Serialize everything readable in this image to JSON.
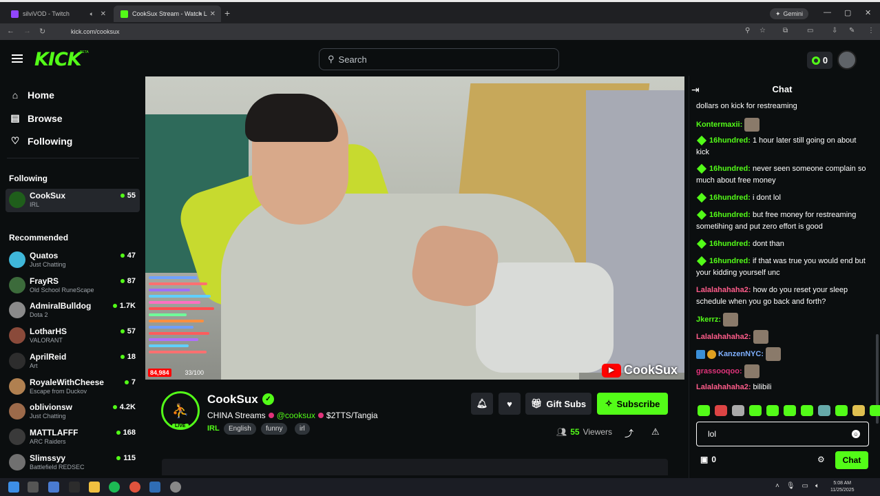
{
  "browser": {
    "tabs": [
      {
        "title": "silviVOD - Twitch",
        "favicon_color": "#9146ff"
      },
      {
        "title": "CookSux Stream - Watch L",
        "favicon_color": "#53fc18"
      }
    ],
    "new_tab": "+",
    "gemini_label": "Gemini",
    "url": "kick.com/cooksux"
  },
  "header": {
    "logo": "KICK",
    "logo_sup": "BETA",
    "search_placeholder": "Search",
    "coins": "0"
  },
  "sidebar": {
    "nav": [
      {
        "label": "Home",
        "icon": "home-icon"
      },
      {
        "label": "Browse",
        "icon": "browse-icon"
      },
      {
        "label": "Following",
        "icon": "heart-icon"
      }
    ],
    "following_heading": "Following",
    "following": [
      {
        "name": "CookSux",
        "category": "IRL",
        "viewers": "55",
        "avatar_color": "#1f5e1b"
      }
    ],
    "recommended_heading": "Recommended",
    "recommended": [
      {
        "name": "Quatos",
        "category": "Just Chatting",
        "viewers": "47",
        "avatar_color": "#3fb7d9"
      },
      {
        "name": "FrayRS",
        "category": "Old School RuneScape",
        "viewers": "87",
        "avatar_color": "#3c6b3b"
      },
      {
        "name": "AdmiralBulldog",
        "category": "Dota 2",
        "viewers": "1.7K",
        "avatar_color": "#8a8a8a"
      },
      {
        "name": "LotharHS",
        "category": "VALORANT",
        "viewers": "57",
        "avatar_color": "#8a4a3a"
      },
      {
        "name": "AprilReid",
        "category": "Art",
        "viewers": "18",
        "avatar_color": "#2d2d2d"
      },
      {
        "name": "RoyaleWithCheese",
        "category": "Escape from Duckov",
        "viewers": "7",
        "avatar_color": "#b08050"
      },
      {
        "name": "oblivionsw",
        "category": "Just Chatting",
        "viewers": "4.2K",
        "avatar_color": "#9c6a4a"
      },
      {
        "name": "MATTLAFFF",
        "category": "ARC Raiders",
        "viewers": "168",
        "avatar_color": "#3a3a3a"
      },
      {
        "name": "Slimssyy",
        "category": "Battlefield REDSEC",
        "viewers": "115",
        "avatar_color": "#707070"
      }
    ]
  },
  "video": {
    "viewer_count_overlay": "84,984",
    "overlay_counter": "33/100",
    "watermark": "CookSux"
  },
  "channel": {
    "name": "CookSux",
    "live_badge": "LIVE",
    "title_prefix": "CHINA Streams",
    "title_handle": "@cooksux",
    "title_suffix": "$2TTS/Tangia",
    "category": "IRL",
    "tags": [
      "English",
      "funny",
      "irl"
    ],
    "viewers": "55",
    "viewers_label": "Viewers",
    "gift_label": "Gift Subs",
    "subscribe_label": "Subscribe"
  },
  "chat": {
    "title": "Chat",
    "messages": [
      {
        "user": "",
        "text": "dollars on kick for restreaming",
        "color": "#ffffff"
      },
      {
        "user": "Kontermaxii:",
        "text": "",
        "color": "#53fc18"
      },
      {
        "user": "16hundred:",
        "text": "1 hour later still going on about kick",
        "color": "#53fc18"
      },
      {
        "user": "16hundred:",
        "text": "never seen someone complain so much about free money",
        "color": "#53fc18"
      },
      {
        "user": "16hundred:",
        "text": "i dont lol",
        "color": "#53fc18"
      },
      {
        "user": "16hundred:",
        "text": "but free money for restreaming sometihing and put zero effort is good",
        "color": "#53fc18"
      },
      {
        "user": "16hundred:",
        "text": "dont than",
        "color": "#53fc18"
      },
      {
        "user": "16hundred:",
        "text": "if that was true you would end but your kidding yourself unc",
        "color": "#53fc18"
      },
      {
        "user": "Lalalahahaha2:",
        "text": "how do you reset your sleep schedule when you go back and forth?",
        "color": "#ff5c8a"
      },
      {
        "user": "Jkerrz:",
        "text": "",
        "color": "#53fc18"
      },
      {
        "user": "Lalalahahaha2:",
        "text": "",
        "color": "#ff5c8a"
      },
      {
        "user": "KanzenNYC:",
        "text": "",
        "color": "#7fb0ff"
      },
      {
        "user": "grassooqoo:",
        "text": "",
        "color": "#e0337a"
      },
      {
        "user": "Lalalahahaha2:",
        "text": "bilibili",
        "color": "#ff5c8a"
      }
    ],
    "input_value": "lol",
    "points": "0",
    "send_label": "Chat"
  },
  "taskbar": {
    "clock_time": "5:08 AM",
    "clock_date": "11/25/2025"
  }
}
